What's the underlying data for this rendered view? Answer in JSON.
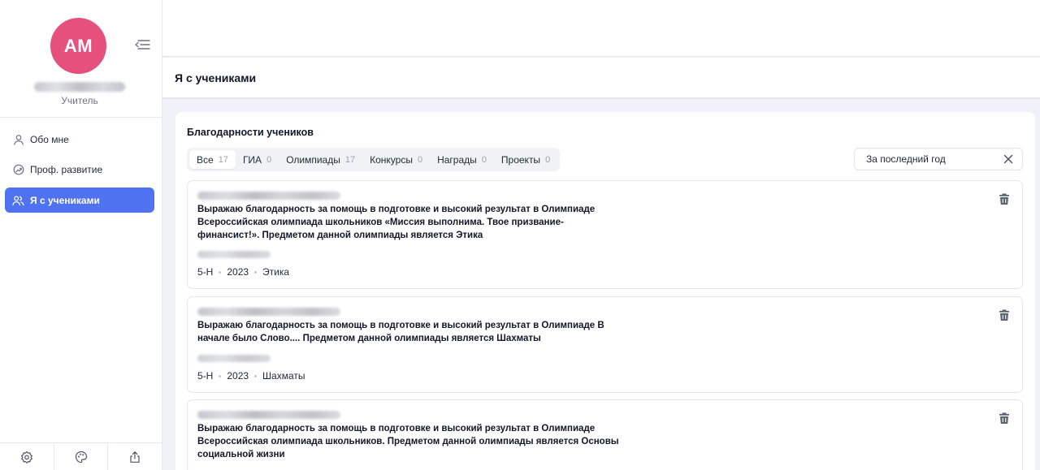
{
  "user": {
    "initials": "АМ",
    "role": "Учитель",
    "avatar_color": "#e5507c"
  },
  "sidebar": {
    "items": [
      {
        "label": "Обо мне",
        "icon": "user-icon"
      },
      {
        "label": "Проф. развитие",
        "icon": "growth-icon"
      },
      {
        "label": "Я с учениками",
        "icon": "users-icon",
        "active": true
      }
    ],
    "bottom": [
      "settings-icon",
      "palette-icon",
      "share-icon"
    ]
  },
  "page": {
    "title": "Я с учениками"
  },
  "panel": {
    "title": "Благодарности учеников",
    "tabs": [
      {
        "label": "Все",
        "count": "17",
        "active": true
      },
      {
        "label": "ГИА",
        "count": "0"
      },
      {
        "label": "Олимпиады",
        "count": "17"
      },
      {
        "label": "Конкурсы",
        "count": "0"
      },
      {
        "label": "Награды",
        "count": "0"
      },
      {
        "label": "Проекты",
        "count": "0"
      }
    ],
    "period": "За последний год",
    "cards": [
      {
        "message": "Выражаю благодарность за помощь в подготовке и высокий результат в Олимпиаде Всероссийская олимпиада школьников «Миссия выполнима. Твое призвание-финансист!». Предметом данной олимпиады является Этика",
        "class": "5-Н",
        "year": "2023",
        "subject": "Этика"
      },
      {
        "message": "Выражаю благодарность за помощь в подготовке и высокий результат в Олимпиаде В начале было Слово.... Предметом данной олимпиады является Шахматы",
        "class": "5-Н",
        "year": "2023",
        "subject": "Шахматы"
      },
      {
        "message": "Выражаю благодарность за помощь в подготовке и высокий результат в Олимпиаде Всероссийская олимпиада школьников. Предметом данной олимпиады является Основы социальной жизни"
      }
    ]
  },
  "colors": {
    "accent": "#4f73f0",
    "background": "#f0f2fa"
  }
}
